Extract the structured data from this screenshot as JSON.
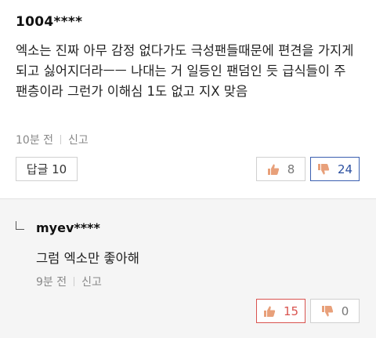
{
  "comment": {
    "username": "1004****",
    "text": "엑소는 진짜 아무 감정 없다가도 극성팬들때문에 편견을 가지게 되고 싫어지더라ㅡㅡ 나대는 거 일등인 팬덤인 듯 급식들이 주 팬층이라 그런가 이해심 1도 없고 지X 맞음",
    "time": "10분 전",
    "report_label": "신고",
    "reply_label": "답글 10",
    "like_count": "8",
    "dislike_count": "24"
  },
  "reply": {
    "username": "myev****",
    "text": "그럼 엑소만 좋아해",
    "time": "9분 전",
    "report_label": "신고",
    "like_count": "15",
    "dislike_count": "0"
  },
  "icons": {
    "like": "thumbs-up-icon",
    "dislike": "thumbs-down-icon",
    "reply_arrow": "reply-arrow-icon"
  },
  "colors": {
    "like_active": "#d9534f",
    "dislike_active": "#2b4fa0",
    "thumb_fill": "#e8a07a"
  }
}
